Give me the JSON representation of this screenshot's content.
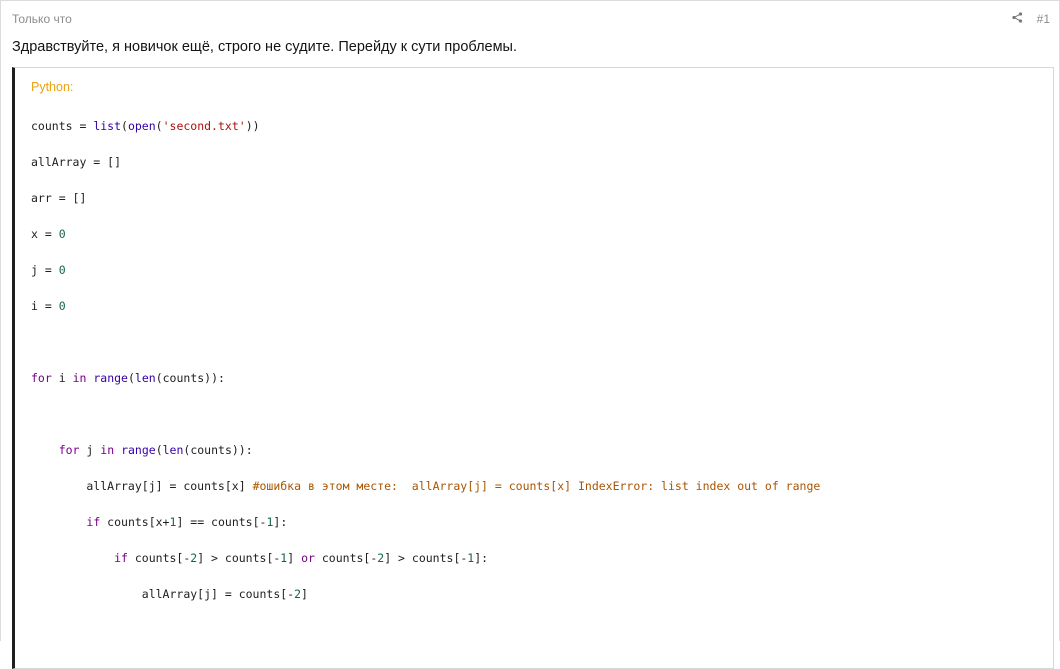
{
  "post": {
    "time": "Только что",
    "number": "#1",
    "share_icon": "share-icon",
    "message": "Здравствуйте, я новичок ещё, строго не судите. Перейду к сути проблемы."
  },
  "code": {
    "language": "Python:",
    "lines": [
      [
        [
          "",
          "counts = "
        ],
        [
          "bi",
          "list"
        ],
        [
          "",
          "("
        ],
        [
          "bi",
          "open"
        ],
        [
          "",
          "("
        ],
        [
          "st",
          "'second.txt'"
        ],
        [
          "",
          "))"
        ]
      ],
      [
        [
          "",
          "allArray = []"
        ]
      ],
      [
        [
          "",
          "arr = []"
        ]
      ],
      [
        [
          "",
          "x = "
        ],
        [
          "nu",
          "0"
        ]
      ],
      [
        [
          "",
          "j = "
        ],
        [
          "nu",
          "0"
        ]
      ],
      [
        [
          "",
          "i = "
        ],
        [
          "nu",
          "0"
        ]
      ],
      [],
      [
        [
          "kw",
          "for"
        ],
        [
          "",
          " i "
        ],
        [
          "kw",
          "in"
        ],
        [
          "",
          " "
        ],
        [
          "bi",
          "range"
        ],
        [
          "",
          "("
        ],
        [
          "bi",
          "len"
        ],
        [
          "",
          "(counts)):"
        ]
      ],
      [],
      [
        [
          "",
          "    "
        ],
        [
          "kw",
          "for"
        ],
        [
          "",
          " j "
        ],
        [
          "kw",
          "in"
        ],
        [
          "",
          " "
        ],
        [
          "bi",
          "range"
        ],
        [
          "",
          "("
        ],
        [
          "bi",
          "len"
        ],
        [
          "",
          "(counts)):"
        ]
      ],
      [
        [
          "",
          "        allArray[j] = counts[x] "
        ],
        [
          "cm",
          "#ошибка в этом месте:  allArray[j] = counts[x] IndexError: list index out of range"
        ]
      ],
      [
        [
          "",
          "        "
        ],
        [
          "kw",
          "if"
        ],
        [
          "",
          " counts[x+"
        ],
        [
          "nu",
          "1"
        ],
        [
          "",
          "] == counts[-"
        ],
        [
          "nu",
          "1"
        ],
        [
          "",
          "]:"
        ]
      ],
      [
        [
          "",
          "            "
        ],
        [
          "kw",
          "if"
        ],
        [
          "",
          " counts[-"
        ],
        [
          "nu",
          "2"
        ],
        [
          "",
          "] > counts[-"
        ],
        [
          "nu",
          "1"
        ],
        [
          "",
          "] "
        ],
        [
          "kw",
          "or"
        ],
        [
          "",
          " counts[-"
        ],
        [
          "nu",
          "2"
        ],
        [
          "",
          "] > counts[-"
        ],
        [
          "nu",
          "1"
        ],
        [
          "",
          "]:"
        ]
      ],
      [
        [
          "",
          "                allArray[j] = counts[-"
        ],
        [
          "nu",
          "2"
        ],
        [
          "",
          "]"
        ]
      ]
    ]
  }
}
